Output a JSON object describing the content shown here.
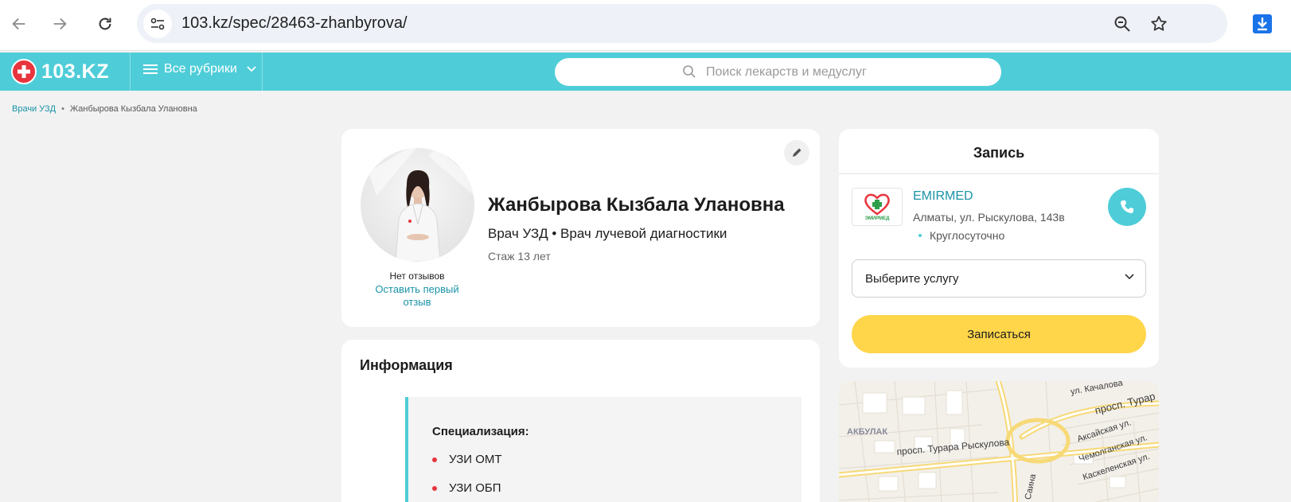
{
  "browser": {
    "url": "103.kz/spec/28463-zhanbyrova/",
    "icons": {
      "back": "arrow-left-icon",
      "forward": "arrow-right-icon",
      "reload": "reload-icon",
      "site_info": "site-settings-icon",
      "zoom": "zoom-out-icon",
      "bookmark": "star-icon",
      "download": "download-icon"
    }
  },
  "header": {
    "logo_text": "103.KZ",
    "rubrics_label": "Все рубрики",
    "search_placeholder": "Поиск лекарств и медуслуг",
    "accent_color": "#4ecdd8"
  },
  "breadcrumb": {
    "items": [
      "Врачи УЗД",
      "Жанбырова Кызбала Улановна"
    ]
  },
  "profile": {
    "name": "Жанбырова Кызбала Улановна",
    "specialties": "Врач УЗД • Врач лучевой диагностики",
    "experience": "Стаж 13 лет",
    "reviews_status": "Нет отзывов",
    "leave_review_link": "Оставить первый отзыв"
  },
  "info": {
    "title": "Информация",
    "specialization_heading": "Специализация:",
    "specializations": [
      "УЗИ ОМТ",
      "УЗИ ОБП"
    ]
  },
  "booking": {
    "title": "Запись",
    "clinic": {
      "name": "EMIRMED",
      "logo_text": "ЭМИРМЕД",
      "address": "Алматы, ул. Рыскулова, 143в",
      "hours": "Круглосуточно"
    },
    "service_select": "Выберите услугу",
    "submit_label": "Записаться",
    "button_color": "#ffd54a"
  },
  "map": {
    "labels": {
      "kachalova": "ул. Качалова",
      "turar_short": "просп. Турар",
      "akbulak": "АКБУЛАК",
      "aksai": "Аксайская ул.",
      "chemolgan": "Чемолганская ул.",
      "kaskelen": "Каскеленская ул.",
      "ryskulova": "просп. Турара Рыскулова",
      "saina": "ул. Саина"
    }
  }
}
